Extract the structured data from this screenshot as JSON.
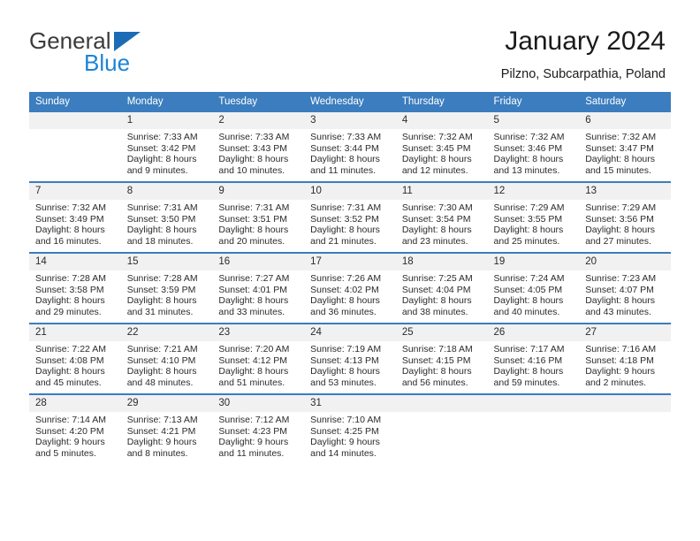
{
  "brand": {
    "name_part1": "General",
    "name_part2": "Blue",
    "triangle_color": "#1b6cb4",
    "blue_color": "#1d84d4"
  },
  "header": {
    "title": "January 2024",
    "location": "Pilzno, Subcarpathia, Poland",
    "accent_color": "#3b7dbe",
    "daynum_band_color": "#f1f1f1"
  },
  "calendar": {
    "weekday_headers": [
      "Sunday",
      "Monday",
      "Tuesday",
      "Wednesday",
      "Thursday",
      "Friday",
      "Saturday"
    ],
    "weeks": [
      [
        {
          "day": "",
          "blank": true,
          "sunrise": "",
          "sunset": "",
          "daylight1": "",
          "daylight2": ""
        },
        {
          "day": "1",
          "sunrise": "Sunrise: 7:33 AM",
          "sunset": "Sunset: 3:42 PM",
          "daylight1": "Daylight: 8 hours",
          "daylight2": "and 9 minutes."
        },
        {
          "day": "2",
          "sunrise": "Sunrise: 7:33 AM",
          "sunset": "Sunset: 3:43 PM",
          "daylight1": "Daylight: 8 hours",
          "daylight2": "and 10 minutes."
        },
        {
          "day": "3",
          "sunrise": "Sunrise: 7:33 AM",
          "sunset": "Sunset: 3:44 PM",
          "daylight1": "Daylight: 8 hours",
          "daylight2": "and 11 minutes."
        },
        {
          "day": "4",
          "sunrise": "Sunrise: 7:32 AM",
          "sunset": "Sunset: 3:45 PM",
          "daylight1": "Daylight: 8 hours",
          "daylight2": "and 12 minutes."
        },
        {
          "day": "5",
          "sunrise": "Sunrise: 7:32 AM",
          "sunset": "Sunset: 3:46 PM",
          "daylight1": "Daylight: 8 hours",
          "daylight2": "and 13 minutes."
        },
        {
          "day": "6",
          "sunrise": "Sunrise: 7:32 AM",
          "sunset": "Sunset: 3:47 PM",
          "daylight1": "Daylight: 8 hours",
          "daylight2": "and 15 minutes."
        }
      ],
      [
        {
          "day": "7",
          "sunrise": "Sunrise: 7:32 AM",
          "sunset": "Sunset: 3:49 PM",
          "daylight1": "Daylight: 8 hours",
          "daylight2": "and 16 minutes."
        },
        {
          "day": "8",
          "sunrise": "Sunrise: 7:31 AM",
          "sunset": "Sunset: 3:50 PM",
          "daylight1": "Daylight: 8 hours",
          "daylight2": "and 18 minutes."
        },
        {
          "day": "9",
          "sunrise": "Sunrise: 7:31 AM",
          "sunset": "Sunset: 3:51 PM",
          "daylight1": "Daylight: 8 hours",
          "daylight2": "and 20 minutes."
        },
        {
          "day": "10",
          "sunrise": "Sunrise: 7:31 AM",
          "sunset": "Sunset: 3:52 PM",
          "daylight1": "Daylight: 8 hours",
          "daylight2": "and 21 minutes."
        },
        {
          "day": "11",
          "sunrise": "Sunrise: 7:30 AM",
          "sunset": "Sunset: 3:54 PM",
          "daylight1": "Daylight: 8 hours",
          "daylight2": "and 23 minutes."
        },
        {
          "day": "12",
          "sunrise": "Sunrise: 7:29 AM",
          "sunset": "Sunset: 3:55 PM",
          "daylight1": "Daylight: 8 hours",
          "daylight2": "and 25 minutes."
        },
        {
          "day": "13",
          "sunrise": "Sunrise: 7:29 AM",
          "sunset": "Sunset: 3:56 PM",
          "daylight1": "Daylight: 8 hours",
          "daylight2": "and 27 minutes."
        }
      ],
      [
        {
          "day": "14",
          "sunrise": "Sunrise: 7:28 AM",
          "sunset": "Sunset: 3:58 PM",
          "daylight1": "Daylight: 8 hours",
          "daylight2": "and 29 minutes."
        },
        {
          "day": "15",
          "sunrise": "Sunrise: 7:28 AM",
          "sunset": "Sunset: 3:59 PM",
          "daylight1": "Daylight: 8 hours",
          "daylight2": "and 31 minutes."
        },
        {
          "day": "16",
          "sunrise": "Sunrise: 7:27 AM",
          "sunset": "Sunset: 4:01 PM",
          "daylight1": "Daylight: 8 hours",
          "daylight2": "and 33 minutes."
        },
        {
          "day": "17",
          "sunrise": "Sunrise: 7:26 AM",
          "sunset": "Sunset: 4:02 PM",
          "daylight1": "Daylight: 8 hours",
          "daylight2": "and 36 minutes."
        },
        {
          "day": "18",
          "sunrise": "Sunrise: 7:25 AM",
          "sunset": "Sunset: 4:04 PM",
          "daylight1": "Daylight: 8 hours",
          "daylight2": "and 38 minutes."
        },
        {
          "day": "19",
          "sunrise": "Sunrise: 7:24 AM",
          "sunset": "Sunset: 4:05 PM",
          "daylight1": "Daylight: 8 hours",
          "daylight2": "and 40 minutes."
        },
        {
          "day": "20",
          "sunrise": "Sunrise: 7:23 AM",
          "sunset": "Sunset: 4:07 PM",
          "daylight1": "Daylight: 8 hours",
          "daylight2": "and 43 minutes."
        }
      ],
      [
        {
          "day": "21",
          "sunrise": "Sunrise: 7:22 AM",
          "sunset": "Sunset: 4:08 PM",
          "daylight1": "Daylight: 8 hours",
          "daylight2": "and 45 minutes."
        },
        {
          "day": "22",
          "sunrise": "Sunrise: 7:21 AM",
          "sunset": "Sunset: 4:10 PM",
          "daylight1": "Daylight: 8 hours",
          "daylight2": "and 48 minutes."
        },
        {
          "day": "23",
          "sunrise": "Sunrise: 7:20 AM",
          "sunset": "Sunset: 4:12 PM",
          "daylight1": "Daylight: 8 hours",
          "daylight2": "and 51 minutes."
        },
        {
          "day": "24",
          "sunrise": "Sunrise: 7:19 AM",
          "sunset": "Sunset: 4:13 PM",
          "daylight1": "Daylight: 8 hours",
          "daylight2": "and 53 minutes."
        },
        {
          "day": "25",
          "sunrise": "Sunrise: 7:18 AM",
          "sunset": "Sunset: 4:15 PM",
          "daylight1": "Daylight: 8 hours",
          "daylight2": "and 56 minutes."
        },
        {
          "day": "26",
          "sunrise": "Sunrise: 7:17 AM",
          "sunset": "Sunset: 4:16 PM",
          "daylight1": "Daylight: 8 hours",
          "daylight2": "and 59 minutes."
        },
        {
          "day": "27",
          "sunrise": "Sunrise: 7:16 AM",
          "sunset": "Sunset: 4:18 PM",
          "daylight1": "Daylight: 9 hours",
          "daylight2": "and 2 minutes."
        }
      ],
      [
        {
          "day": "28",
          "sunrise": "Sunrise: 7:14 AM",
          "sunset": "Sunset: 4:20 PM",
          "daylight1": "Daylight: 9 hours",
          "daylight2": "and 5 minutes."
        },
        {
          "day": "29",
          "sunrise": "Sunrise: 7:13 AM",
          "sunset": "Sunset: 4:21 PM",
          "daylight1": "Daylight: 9 hours",
          "daylight2": "and 8 minutes."
        },
        {
          "day": "30",
          "sunrise": "Sunrise: 7:12 AM",
          "sunset": "Sunset: 4:23 PM",
          "daylight1": "Daylight: 9 hours",
          "daylight2": "and 11 minutes."
        },
        {
          "day": "31",
          "sunrise": "Sunrise: 7:10 AM",
          "sunset": "Sunset: 4:25 PM",
          "daylight1": "Daylight: 9 hours",
          "daylight2": "and 14 minutes."
        },
        {
          "day": "",
          "blank": true,
          "sunrise": "",
          "sunset": "",
          "daylight1": "",
          "daylight2": ""
        },
        {
          "day": "",
          "blank": true,
          "sunrise": "",
          "sunset": "",
          "daylight1": "",
          "daylight2": ""
        },
        {
          "day": "",
          "blank": true,
          "sunrise": "",
          "sunset": "",
          "daylight1": "",
          "daylight2": ""
        }
      ]
    ]
  }
}
